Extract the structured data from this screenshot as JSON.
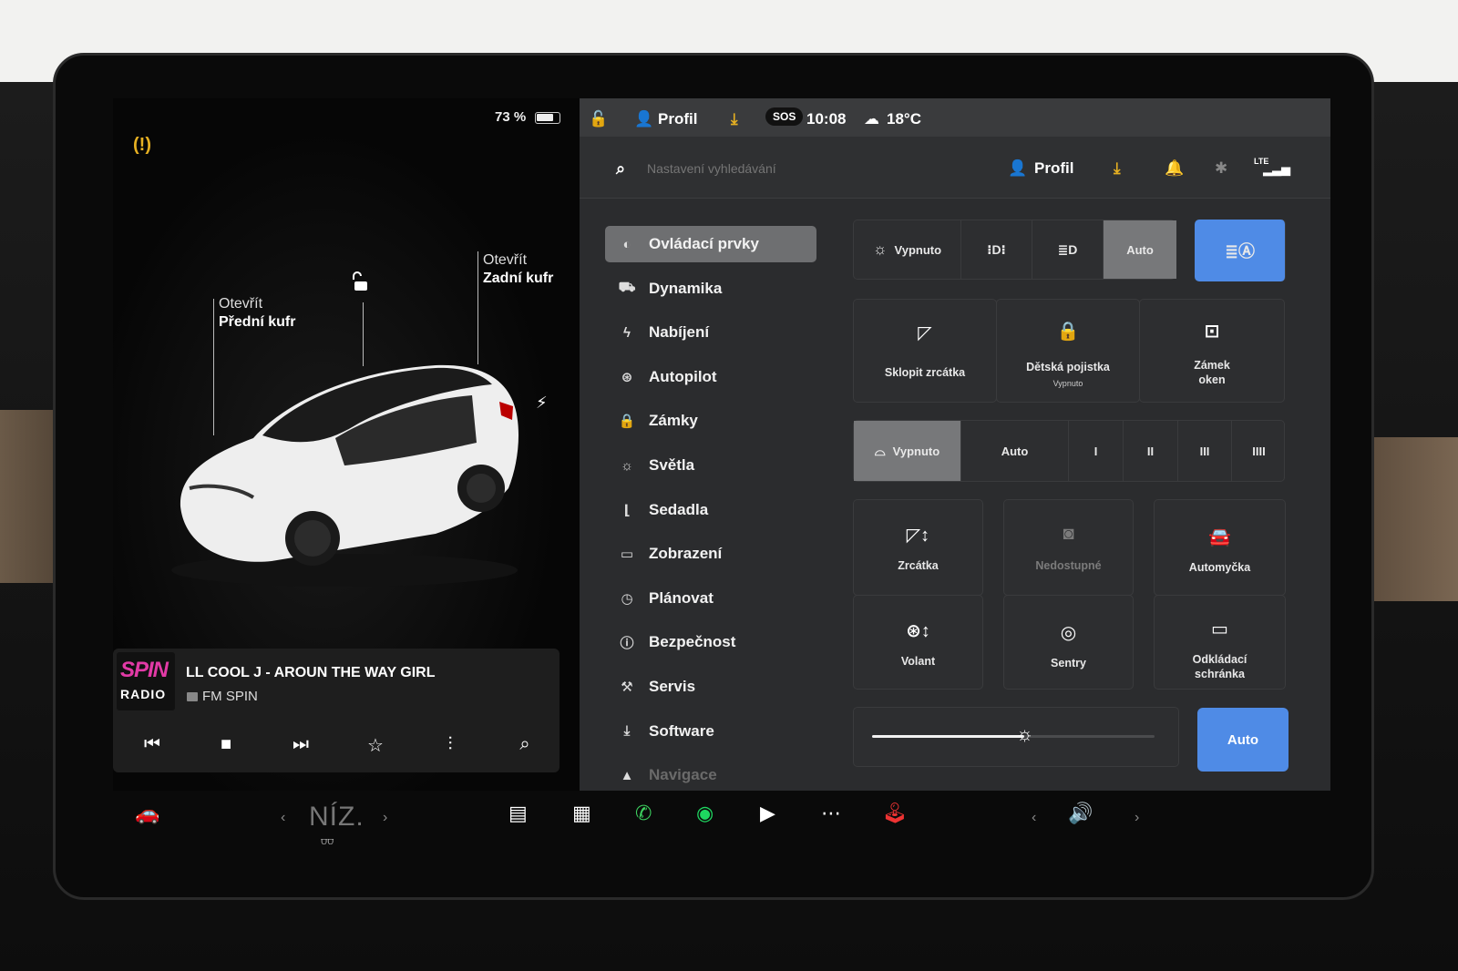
{
  "left_panel": {
    "battery_percent": "73 %",
    "battery_level": 0.73,
    "front_trunk": {
      "line1": "Otevřít",
      "line2": "Přední kufr"
    },
    "rear_trunk": {
      "line1": "Otevřít",
      "line2": "Zadní kufr"
    }
  },
  "media": {
    "logo_top": "SPIN",
    "logo_bottom": "RADIO",
    "song": "LL COOL J - AROUN THE WAY GIRL",
    "station": "FM SPIN"
  },
  "status_bar": {
    "profile": "Profil",
    "sos": "SOS",
    "time": "10:08",
    "temperature": "18°C"
  },
  "header": {
    "search_placeholder": "Nastavení vyhledávání",
    "profile": "Profil",
    "lte": "LTE"
  },
  "menu": [
    {
      "label": "Ovládací prvky",
      "icon": "toggle-icon",
      "active": true
    },
    {
      "label": "Dynamika",
      "icon": "car-icon"
    },
    {
      "label": "Nabíjení",
      "icon": "bolt-icon"
    },
    {
      "label": "Autopilot",
      "icon": "steering-wheel-icon"
    },
    {
      "label": "Zámky",
      "icon": "lock-icon"
    },
    {
      "label": "Světla",
      "icon": "light-icon"
    },
    {
      "label": "Sedadla",
      "icon": "seat-icon"
    },
    {
      "label": "Zobrazení",
      "icon": "display-icon"
    },
    {
      "label": "Plánovat",
      "icon": "alarm-clock-icon"
    },
    {
      "label": "Bezpečnost",
      "icon": "alert-circle-icon"
    },
    {
      "label": "Servis",
      "icon": "wrench-icon"
    },
    {
      "label": "Software",
      "icon": "download-icon"
    },
    {
      "label": "Navigace",
      "icon": "navigation-icon"
    }
  ],
  "lights": {
    "off": "Vypnuto",
    "auto": "Auto"
  },
  "quick_tiles": {
    "fold_mirrors": "Sklopit zrcátka",
    "child_lock": "Dětská pojistka",
    "child_lock_state": "Vypnuto",
    "window_lock_1": "Zámek",
    "window_lock_2": "oken"
  },
  "wipers": {
    "off": "Vypnuto",
    "auto": "Auto",
    "speeds": [
      "I",
      "II",
      "III",
      "IIII"
    ]
  },
  "adjust_tiles": {
    "mirrors": "Zrcátka",
    "unavailable": "Nedostupné",
    "car_wash": "Automyčka",
    "wheel": "Volant",
    "sentry": "Sentry",
    "glovebox_1": "Odkládací",
    "glovebox_2": "schránka"
  },
  "brightness": {
    "level": 0.54,
    "auto": "Auto"
  },
  "dock": {
    "climate_label": "NÍZ."
  }
}
